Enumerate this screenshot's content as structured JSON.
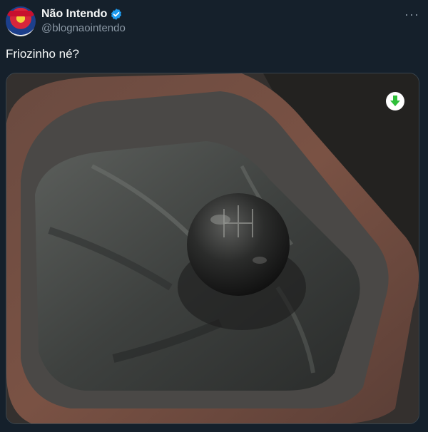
{
  "author": {
    "display_name": "Não Intendo",
    "handle": "@blognaointendo",
    "verified": true,
    "avatar_icon": "blog-logo-avatar"
  },
  "menu": {
    "more_icon": "more-options-icon",
    "more_label": "···"
  },
  "tweet": {
    "text": "Friozinho né?"
  },
  "media": {
    "subject": "car gear shift knob with leather boot",
    "download_icon": "green-down-arrow-icon"
  },
  "colors": {
    "background": "#15202b",
    "primary_text": "#f7f9f9",
    "secondary_text": "#8b98a5",
    "verified_badge": "#1d9bf0",
    "download_arrow": "#2fbf3a"
  }
}
